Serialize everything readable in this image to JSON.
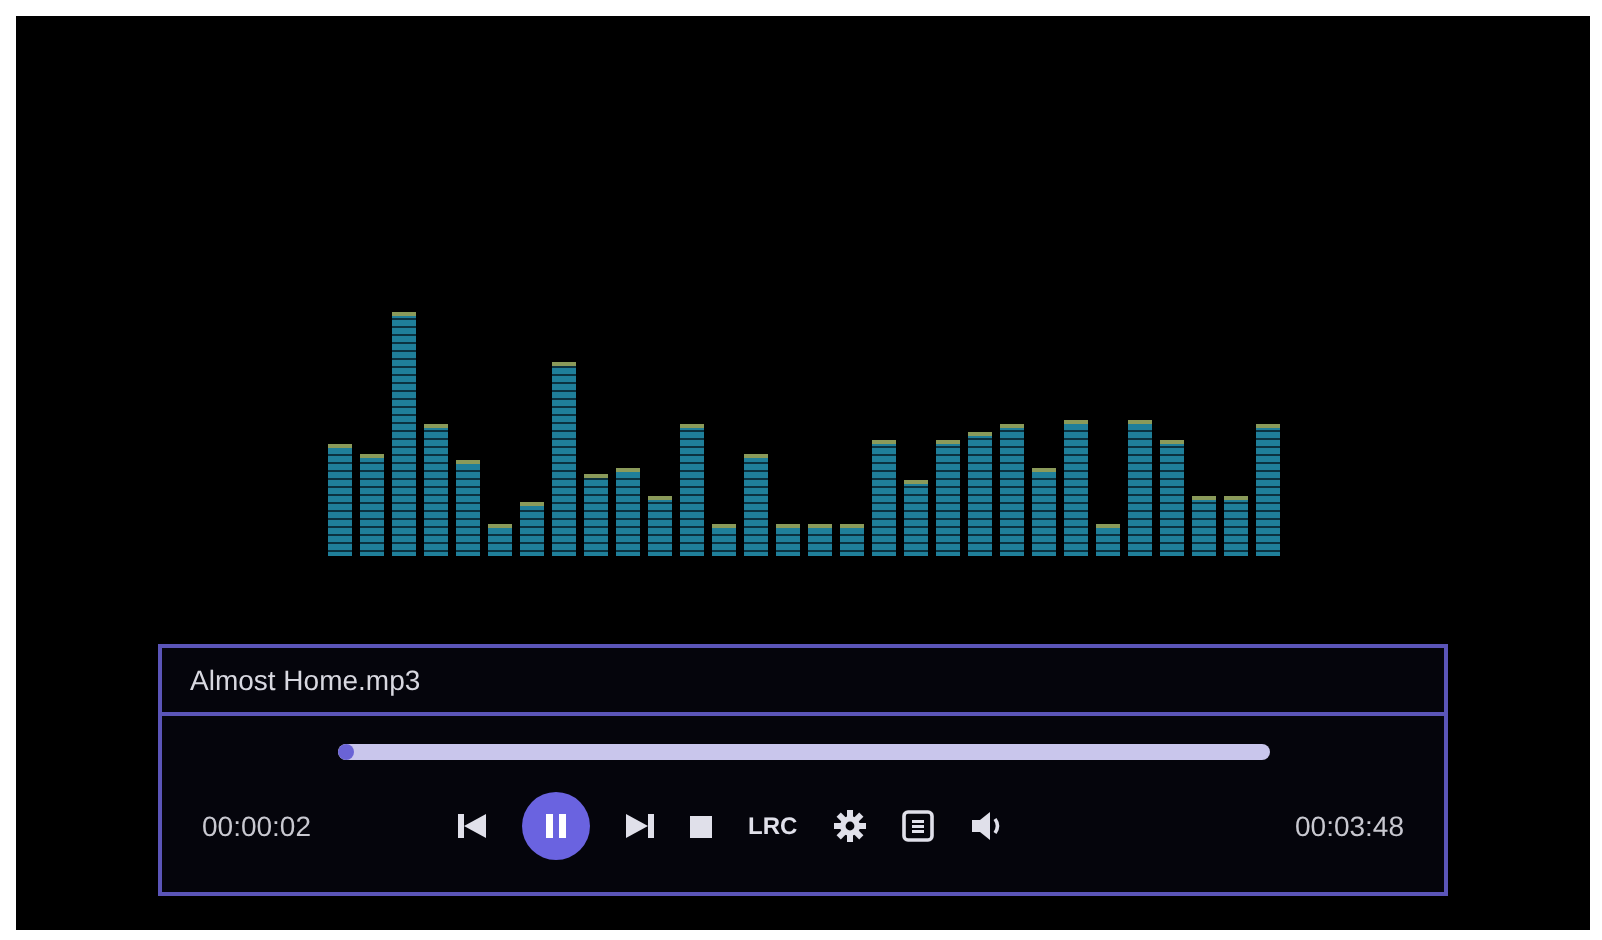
{
  "player": {
    "file_name": "Almost Home.mp3",
    "progress": {
      "level": 0.01
    },
    "elapsed": "00:00:02",
    "controls": [
      {
        "kind": "previous"
      },
      {
        "kind": "pause"
      },
      {
        "kind": "next"
      },
      {
        "kind": "stop"
      },
      {
        "kind": "lyrics",
        "label": "LRC"
      },
      {
        "kind": "settings"
      },
      {
        "kind": "playlist"
      },
      {
        "kind": "volume"
      }
    ],
    "duration": "00:03:48"
  }
}
